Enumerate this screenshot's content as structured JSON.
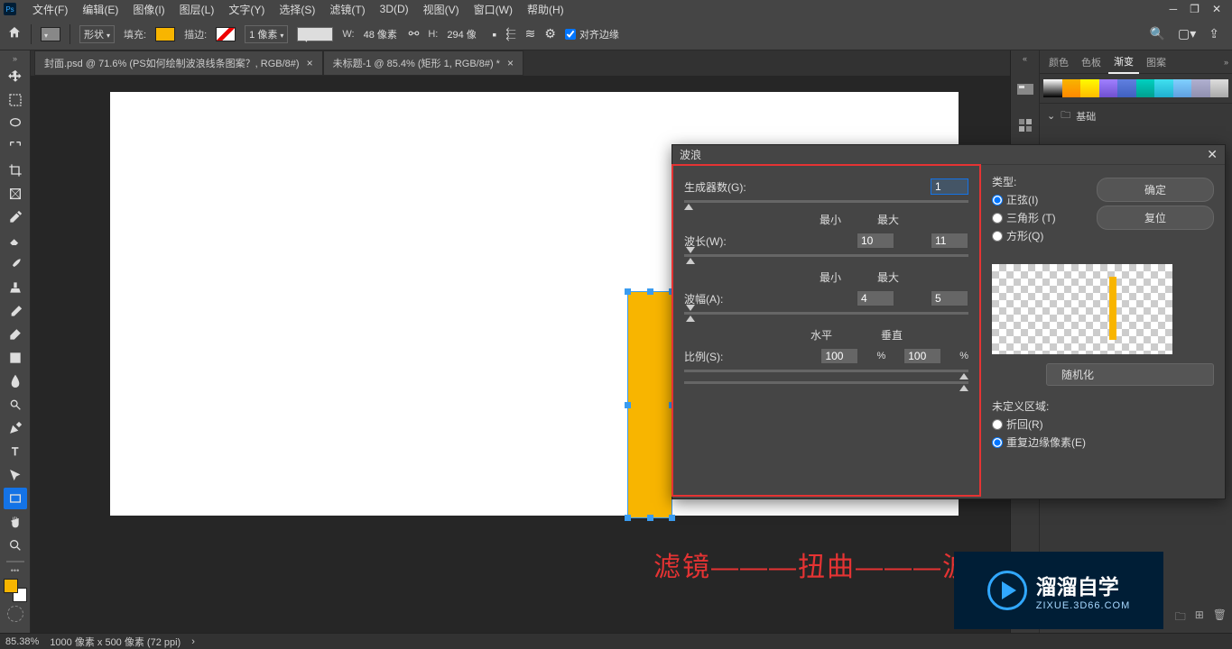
{
  "menu": {
    "items": [
      "文件(F)",
      "编辑(E)",
      "图像(I)",
      "图层(L)",
      "文字(Y)",
      "选择(S)",
      "滤镜(T)",
      "3D(D)",
      "视图(V)",
      "窗口(W)",
      "帮助(H)"
    ]
  },
  "options": {
    "shape_label": "形状",
    "fill_label": "填充:",
    "stroke_label": "描边:",
    "stroke_width": "1 像素",
    "w_label": "W:",
    "w_value": "48 像素",
    "h_label": "H:",
    "h_value": "294 像",
    "align_label": "对齐边缘"
  },
  "tabs": {
    "items": [
      {
        "label": "封面.psd @ 71.6% (PS如何绘制波浪线条图案？, RGB/8#)"
      },
      {
        "label": "未标题-1 @ 85.4% (矩形 1, RGB/8#) *"
      }
    ]
  },
  "annotation": "滤镜———扭曲———波浪",
  "right_panel": {
    "tabs": [
      "颜色",
      "色板",
      "渐变",
      "图案"
    ],
    "active_tab": "渐变",
    "section": "基础"
  },
  "status": {
    "zoom": "85.38%",
    "size": "1000 像素 x 500 像素 (72 ppi)"
  },
  "dialog": {
    "title": "波浪",
    "generators_label": "生成器数(G):",
    "generators_value": "1",
    "min_label": "最小",
    "max_label": "最大",
    "wavelength_label": "波长(W):",
    "wavelength_min": "10",
    "wavelength_max": "11",
    "amplitude_label": "波幅(A):",
    "amplitude_min": "4",
    "amplitude_max": "5",
    "horiz_label": "水平",
    "vert_label": "垂直",
    "scale_label": "比例(S):",
    "scale_h": "100",
    "scale_v": "100",
    "type_label": "类型:",
    "type_sine": "正弦(I)",
    "type_triangle": "三角形 (T)",
    "type_square": "方形(Q)",
    "ok": "确定",
    "cancel": "复位",
    "randomize": "随机化",
    "undefined_label": "未定义区域:",
    "wrap": "折回(R)",
    "repeat": "重复边缘像素(E)"
  },
  "watermark": {
    "cn": "溜溜自学",
    "url": "ZIXUE.3D66.COM"
  }
}
